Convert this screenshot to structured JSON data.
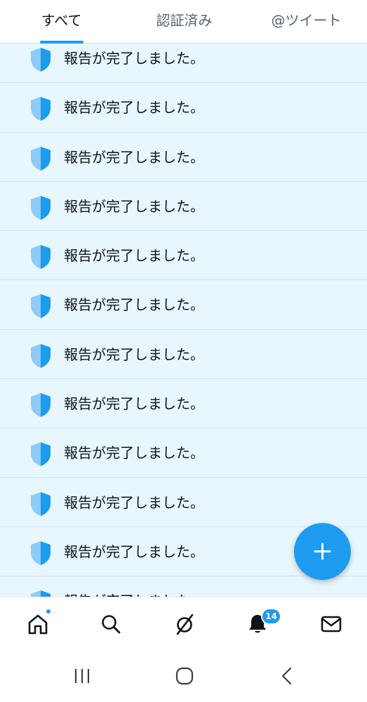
{
  "tabs": [
    {
      "label": "すべて",
      "active": true
    },
    {
      "label": "認証済み",
      "active": false
    },
    {
      "label": "@ツイート",
      "active": false
    }
  ],
  "notifications": [
    {
      "icon": "shield-icon",
      "text": "報告が完了しました。"
    },
    {
      "icon": "shield-icon",
      "text": "報告が完了しました。"
    },
    {
      "icon": "shield-icon",
      "text": "報告が完了しました。"
    },
    {
      "icon": "shield-icon",
      "text": "報告が完了しました。"
    },
    {
      "icon": "shield-icon",
      "text": "報告が完了しました。"
    },
    {
      "icon": "shield-icon",
      "text": "報告が完了しました。"
    },
    {
      "icon": "shield-icon",
      "text": "報告が完了しました。"
    },
    {
      "icon": "shield-icon",
      "text": "報告が完了しました。"
    },
    {
      "icon": "shield-icon",
      "text": "報告が完了しました。"
    },
    {
      "icon": "shield-icon",
      "text": "報告が完了しました。"
    },
    {
      "icon": "shield-icon",
      "text": "報告が完了しました。"
    },
    {
      "icon": "shield-icon",
      "text": "報告が完了しました。"
    }
  ],
  "fab": {
    "icon": "plus-icon"
  },
  "bottom_nav": {
    "items": [
      {
        "icon": "home-icon",
        "has_dot": true
      },
      {
        "icon": "search-icon"
      },
      {
        "icon": "spaces-icon"
      },
      {
        "icon": "bell-icon",
        "badge": "14"
      },
      {
        "icon": "mail-icon"
      }
    ]
  },
  "system_nav": [
    "recent-apps-icon",
    "home-circle-icon",
    "back-icon"
  ],
  "colors": {
    "accent": "#1d9bf0",
    "feed_background": "#e8f7fd",
    "shield_light": "#8ecbf6",
    "shield_dark": "#1d9bf0"
  }
}
